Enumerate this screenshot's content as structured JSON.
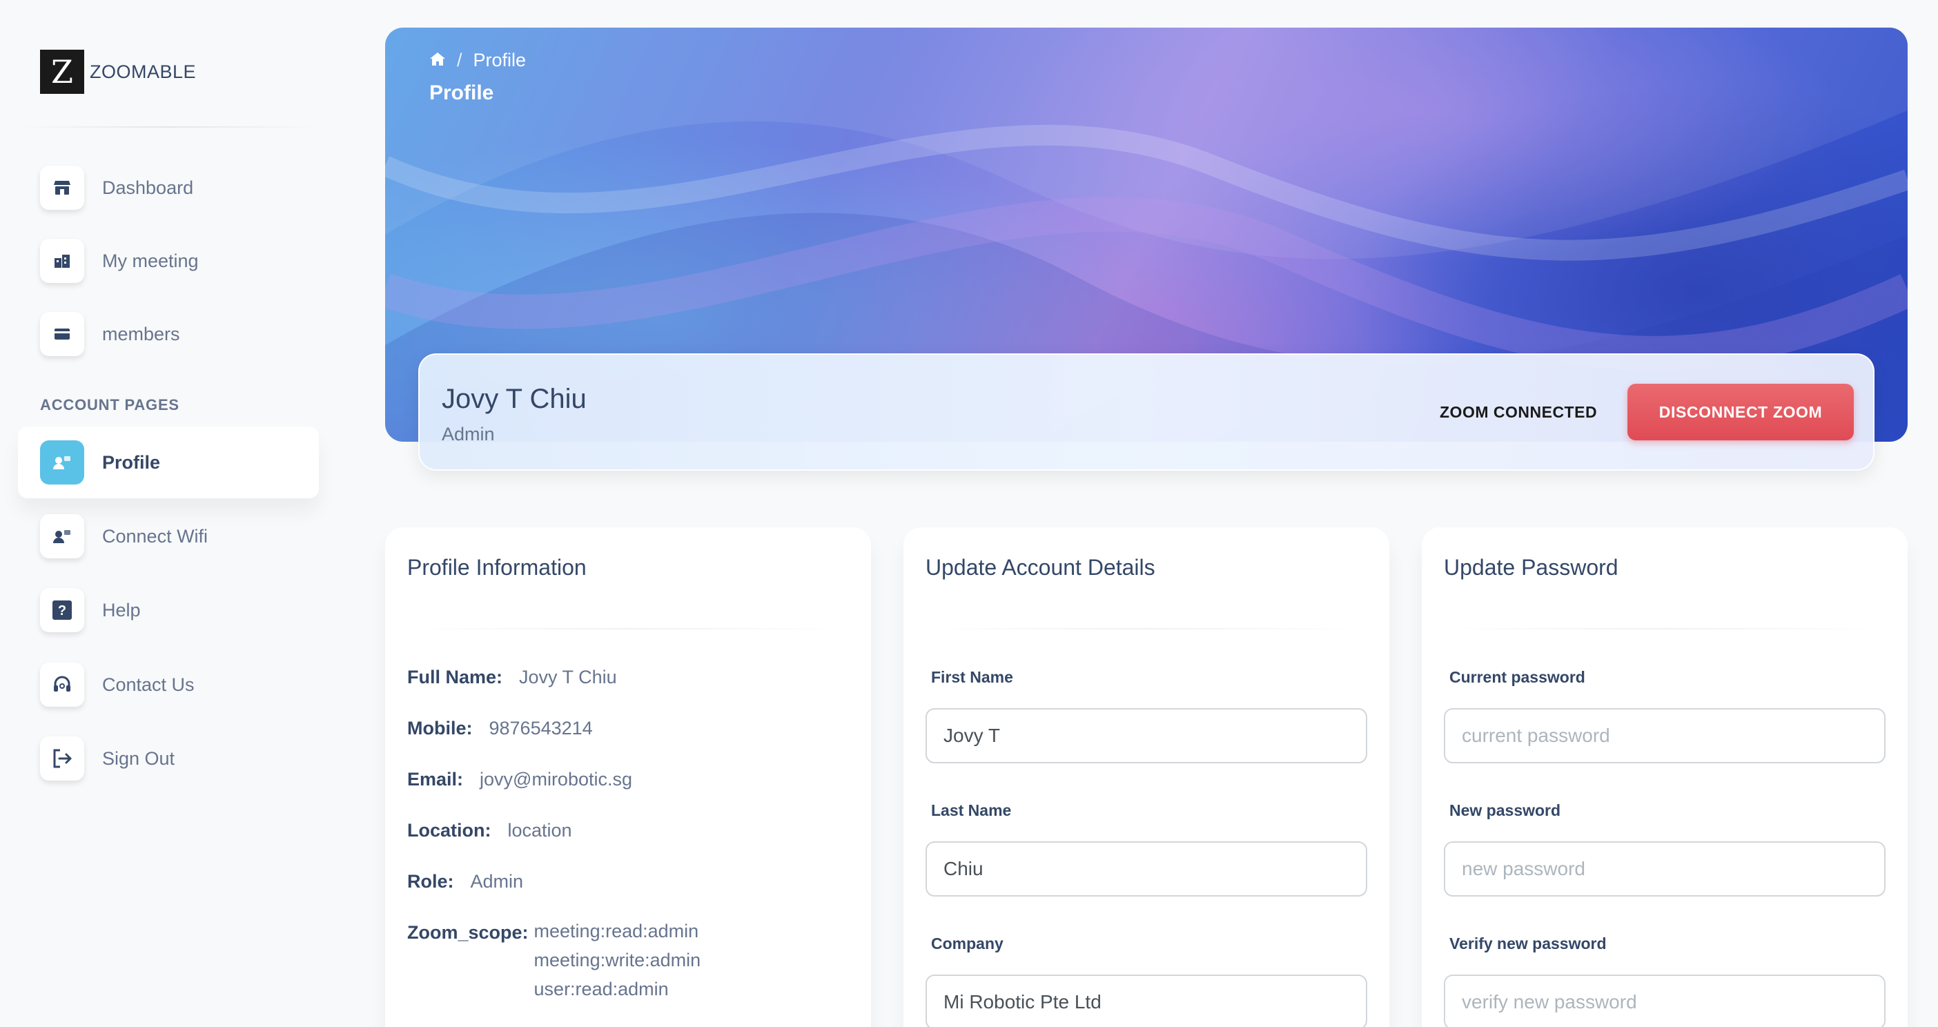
{
  "brand": {
    "logo_letter": "Z",
    "name": "ZOOMABLE"
  },
  "sidebar": {
    "items": [
      {
        "label": "Dashboard",
        "icon": "shop-icon"
      },
      {
        "label": "My meeting",
        "icon": "office-icon"
      },
      {
        "label": "members",
        "icon": "credit-card-icon"
      }
    ],
    "section_label": "ACCOUNT PAGES",
    "account_items": [
      {
        "label": "Profile",
        "icon": "customer-support-icon",
        "active": true
      },
      {
        "label": "Connect Wifi",
        "icon": "customer-support-icon"
      },
      {
        "label": "Help",
        "icon": "question-icon"
      },
      {
        "label": "Contact Us",
        "icon": "headset-icon"
      },
      {
        "label": "Sign Out",
        "icon": "sign-out-icon"
      }
    ]
  },
  "header": {
    "breadcrumb_current": "Profile",
    "title": "Profile"
  },
  "profile": {
    "name": "Jovy T Chiu",
    "role": "Admin",
    "zoom_status": "ZOOM CONNECTED",
    "disconnect_label": "DISCONNECT ZOOM"
  },
  "profile_info": {
    "title": "Profile Information",
    "full_name_key": "Full Name:",
    "full_name": "Jovy T Chiu",
    "mobile_key": "Mobile:",
    "mobile": "9876543214",
    "email_key": "Email:",
    "email": "jovy@mirobotic.sg",
    "location_key": "Location:",
    "location": "location",
    "role_key": "Role:",
    "role": "Admin",
    "scope_key": "Zoom_scope:",
    "scopes": [
      "meeting:read:admin",
      "meeting:write:admin",
      "user:read:admin"
    ]
  },
  "account_details": {
    "title": "Update Account Details",
    "first_name_label": "First Name",
    "first_name": "Jovy T",
    "last_name_label": "Last Name",
    "last_name": "Chiu",
    "company_label": "Company",
    "company": "Mi Robotic Pte Ltd"
  },
  "password": {
    "title": "Update Password",
    "current_label": "Current password",
    "current_placeholder": "current password",
    "new_label": "New password",
    "new_placeholder": "new password",
    "verify_label": "Verify new password",
    "verify_placeholder": "verify new password"
  },
  "colors": {
    "accent": "#5bc2e7",
    "danger": "#e04b55",
    "text": "#344767",
    "muted": "#67748e"
  }
}
